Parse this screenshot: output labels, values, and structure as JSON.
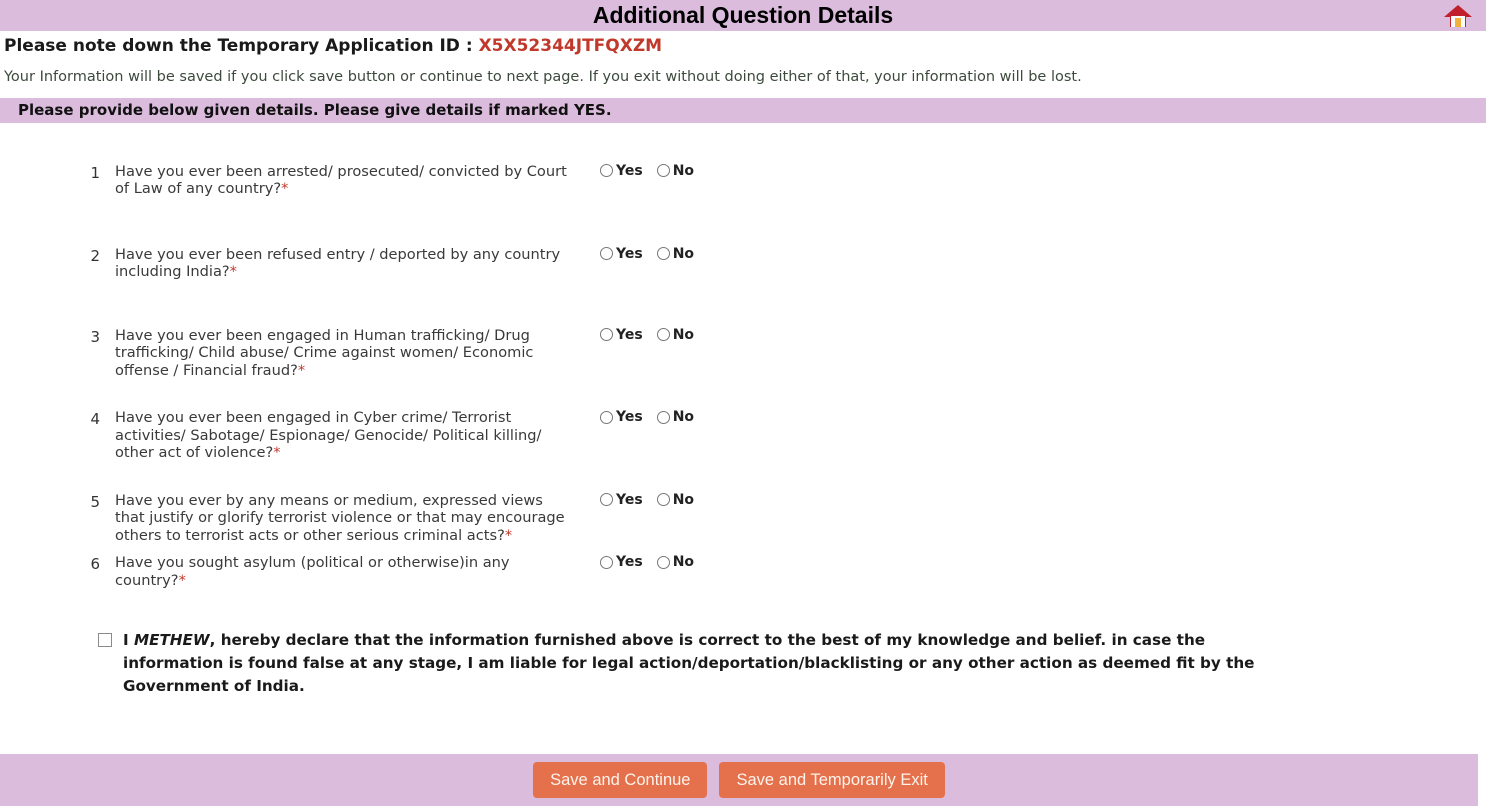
{
  "header": {
    "title": "Additional Question Details",
    "home_icon": "home-icon"
  },
  "notices": {
    "app_id_label": "Please note down the Temporary Application ID : ",
    "app_id_value": "X5X52344JTFQXZM",
    "save_note": "Your Information will be saved if you click save button or continue to next page. If you exit without doing either of that, your information will be lost.",
    "section_bar": "Please provide below given details. Please give details if marked YES."
  },
  "answers": {
    "yes_label": "Yes",
    "no_label": "No"
  },
  "questions": [
    {
      "num": "1",
      "text": "Have you ever been arrested/ prosecuted/ convicted by Court of Law of any country?",
      "required": "*"
    },
    {
      "num": "2",
      "text": "Have you ever been refused entry / deported by any country including India?",
      "required": "*"
    },
    {
      "num": "3",
      "text": "Have you ever been engaged in Human trafficking/ Drug trafficking/ Child abuse/ Crime against women/ Economic offense / Financial fraud?",
      "required": "*"
    },
    {
      "num": "4",
      "text": "Have you ever been engaged in Cyber crime/ Terrorist activities/ Sabotage/ Espionage/ Genocide/ Political killing/ other act of violence?",
      "required": "*"
    },
    {
      "num": "5",
      "text": "Have you ever by any means or medium, expressed views that justify or glorify terrorist violence or that may encourage others to terrorist acts or other serious criminal acts?",
      "required": "*"
    },
    {
      "num": "6",
      "text": "Have you sought asylum (political or otherwise)in any country?",
      "required": "*"
    }
  ],
  "declaration": {
    "prefix": "I ",
    "name": "METHEW",
    "body": ", hereby declare that the information furnished above is correct to the best of my knowledge and belief. in case the information is found false at any stage, I am liable for legal action/deportation/blacklisting or any other action as deemed fit by the Government of India."
  },
  "footer": {
    "save_continue": "Save and Continue",
    "save_exit": "Save and Temporarily Exit"
  },
  "colors": {
    "lavender": "#dbbcdd",
    "accent_orange": "#e5714c",
    "required_red": "#c0392b"
  }
}
